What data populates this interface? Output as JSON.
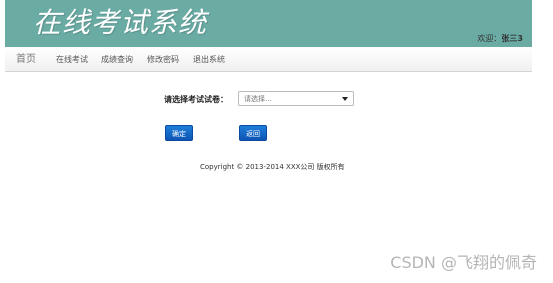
{
  "header": {
    "title": "在线考试系统",
    "welcome_prefix": "欢迎：",
    "user_name": "张三3"
  },
  "nav": {
    "items": [
      {
        "label": "首页"
      },
      {
        "label": "在线考试"
      },
      {
        "label": "成绩查询"
      },
      {
        "label": "修改密码"
      },
      {
        "label": "退出系统"
      }
    ]
  },
  "form": {
    "label": "请选择考试试卷：",
    "select_value": "请选择..."
  },
  "buttons": {
    "ok_label": "确定",
    "back_label": "返回"
  },
  "footer": {
    "copyright": "Copyright © 2013-2014 XXX公司 版权所有"
  },
  "watermark": {
    "text": "CSDN @飞翔的佩奇"
  },
  "colors": {
    "header_bg": "#6aaba4",
    "button_blue": "#0d54b5"
  }
}
